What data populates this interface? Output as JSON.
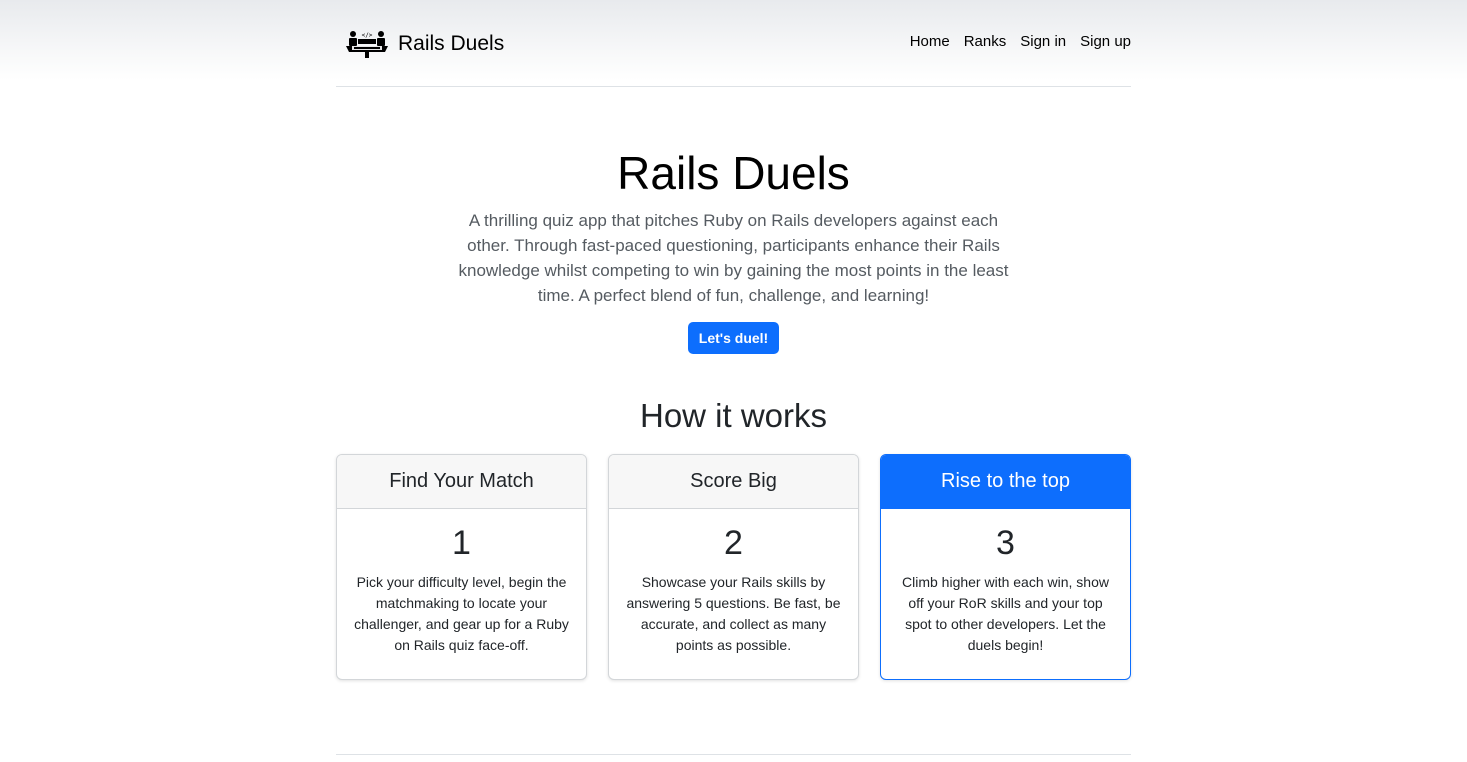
{
  "brand": {
    "name": "Rails Duels",
    "logo_icon": "rails-duels-logo-icon"
  },
  "nav": {
    "items": [
      {
        "label": "Home"
      },
      {
        "label": "Ranks"
      },
      {
        "label": "Sign in"
      },
      {
        "label": "Sign up"
      }
    ]
  },
  "hero": {
    "title": "Rails Duels",
    "description": "A thrilling quiz app that pitches Ruby on Rails developers against each other. Through fast-paced questioning, participants enhance their Rails knowledge whilst competing to win by gaining the most points in the least time. A perfect blend of fun, challenge, and learning!",
    "cta_label": "Let's duel!"
  },
  "how": {
    "title": "How it works",
    "cards": [
      {
        "title": "Find Your Match",
        "number": "1",
        "text": "Pick your difficulty level, begin the matchmaking to locate your challenger, and gear up for a Ruby on Rails quiz face-off."
      },
      {
        "title": "Score Big",
        "number": "2",
        "text": "Showcase your Rails skills by answering 5 questions. Be fast, be accurate, and collect as many points as possible."
      },
      {
        "title": "Rise to the top",
        "number": "3",
        "text": "Climb higher with each win, show off your RoR skills and your top spot to other developers. Let the duels begin!"
      }
    ]
  },
  "colors": {
    "primary": "#0d6efd",
    "card_header_bg": "#f7f7f7",
    "text": "#212529",
    "muted_text": "#555b61"
  }
}
